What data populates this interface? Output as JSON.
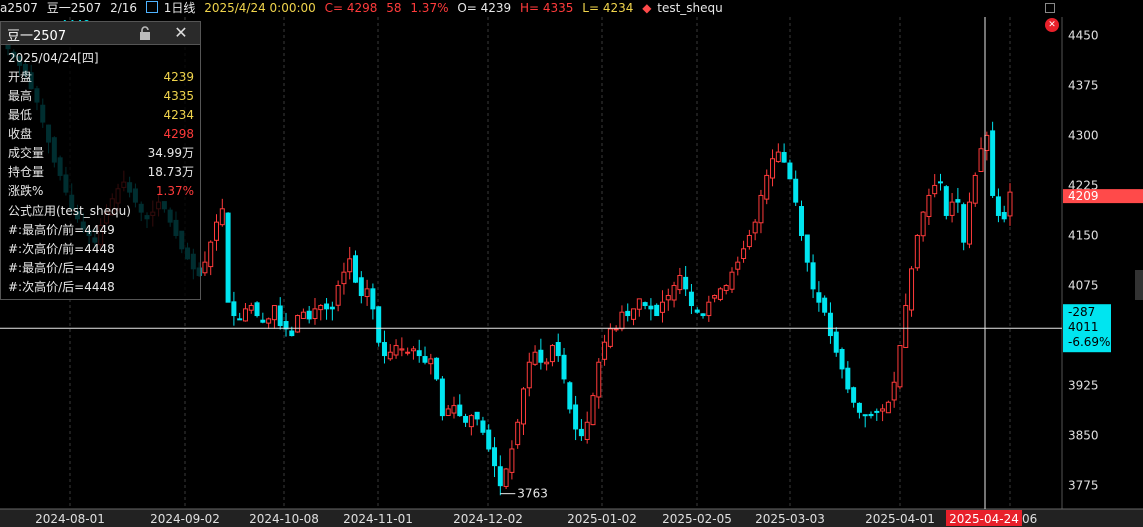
{
  "header": {
    "code": "a2507",
    "name": "豆一2507",
    "fraction": "2/16",
    "period": "1日线",
    "datetime": "2025/4/24 0:00:00",
    "close": "C= 4298",
    "change": "58",
    "pct": "1.37%",
    "open": "O= 4239",
    "high": "H= 4335",
    "low": "L= 4234",
    "formula": "test_shequ"
  },
  "panel": {
    "title": "豆一2507",
    "date": "2025/04/24[四]",
    "rows": [
      {
        "k": "开盘",
        "v": "4239",
        "color": "#f0d44c"
      },
      {
        "k": "最高",
        "v": "4335",
        "color": "#f0d44c"
      },
      {
        "k": "最低",
        "v": "4234",
        "color": "#f0d44c"
      },
      {
        "k": "收盘",
        "v": "4298",
        "color": "#ff3b3b"
      },
      {
        "k": "成交量",
        "v": "34.99万",
        "color": "#e8e8e8"
      },
      {
        "k": "持仓量",
        "v": "18.73万",
        "color": "#e8e8e8"
      },
      {
        "k": "涨跌%",
        "v": "1.37%",
        "color": "#ff3b3b"
      }
    ],
    "formula_label": "公式应用(test_shequ)",
    "formula_lines": [
      "#:最高价/前=4449",
      "#:次高价/前=4448",
      "#:最高价/后=4449",
      "#:次高价/后=4448"
    ]
  },
  "colors": {
    "up": "#ff3b3b",
    "down": "#00e5f0",
    "cursor_box": "#00e5f0",
    "price_tag": "#ff4a4a",
    "date_tag": "#e8202a"
  },
  "chart_data": {
    "type": "candlestick",
    "ylim": [
      3740,
      4470
    ],
    "y_ticks": [
      4450,
      4375,
      4300,
      4225,
      4150,
      4075,
      3925,
      3850,
      3775
    ],
    "x_ticks": [
      "2024-08-01",
      "2024-09-02",
      "2024-10-08",
      "2024-11-01",
      "2024-12-02",
      "2025-01-02",
      "2025-02-05",
      "2025-03-03",
      "2025-04-01"
    ],
    "cursor_date": "2025-04-24",
    "cursor_date_tail": "06",
    "current_price": "4209",
    "cursor_box": [
      "-287",
      "4011",
      "-6.69%"
    ],
    "min_label": "3763",
    "peak_label": "4449",
    "closes": [
      4430,
      4418,
      4405,
      4390,
      4370,
      4350,
      4320,
      4290,
      4260,
      4240,
      4215,
      4190,
      4175,
      4160,
      4150,
      4140,
      4165,
      4185,
      4205,
      4220,
      4230,
      4215,
      4200,
      4185,
      4175,
      4185,
      4200,
      4190,
      4170,
      4150,
      4130,
      4115,
      4100,
      4090,
      4110,
      4140,
      4170,
      4190,
      4050,
      4030,
      4025,
      4040,
      4045,
      4030,
      4020,
      4025,
      4045,
      4015,
      4010,
      4000,
      4030,
      4035,
      4025,
      4040,
      4045,
      4040,
      4040,
      4075,
      4095,
      4115,
      4080,
      4060,
      4070,
      4040,
      3990,
      3970,
      3975,
      3985,
      3980,
      3975,
      3980,
      3970,
      3960,
      3965,
      3935,
      3880,
      3890,
      3895,
      3880,
      3870,
      3880,
      3875,
      3855,
      3830,
      3805,
      3775,
      3800,
      3830,
      3870,
      3920,
      3960,
      3975,
      3960,
      3960,
      3985,
      3970,
      3935,
      3890,
      3860,
      3850,
      3870,
      3910,
      3960,
      3990,
      4010,
      4010,
      4035,
      4030,
      4040,
      4055,
      4045,
      4040,
      4030,
      4050,
      4060,
      4075,
      4090,
      4070,
      4045,
      4035,
      4030,
      4050,
      4060,
      4070,
      4075,
      4095,
      4110,
      4130,
      4150,
      4170,
      4210,
      4240,
      4265,
      4275,
      4260,
      4235,
      4200,
      4150,
      4110,
      4070,
      4050,
      4035,
      4000,
      3975,
      3950,
      3920,
      3900,
      3885,
      3880,
      3880,
      3885,
      3890,
      3900,
      3930,
      3985,
      4045,
      4100,
      4150,
      4185,
      4210,
      4225,
      4230,
      4180,
      4200,
      4200,
      4140,
      4200,
      4240,
      4280,
      4300,
      4210,
      4180,
      4175,
      4215
    ]
  }
}
